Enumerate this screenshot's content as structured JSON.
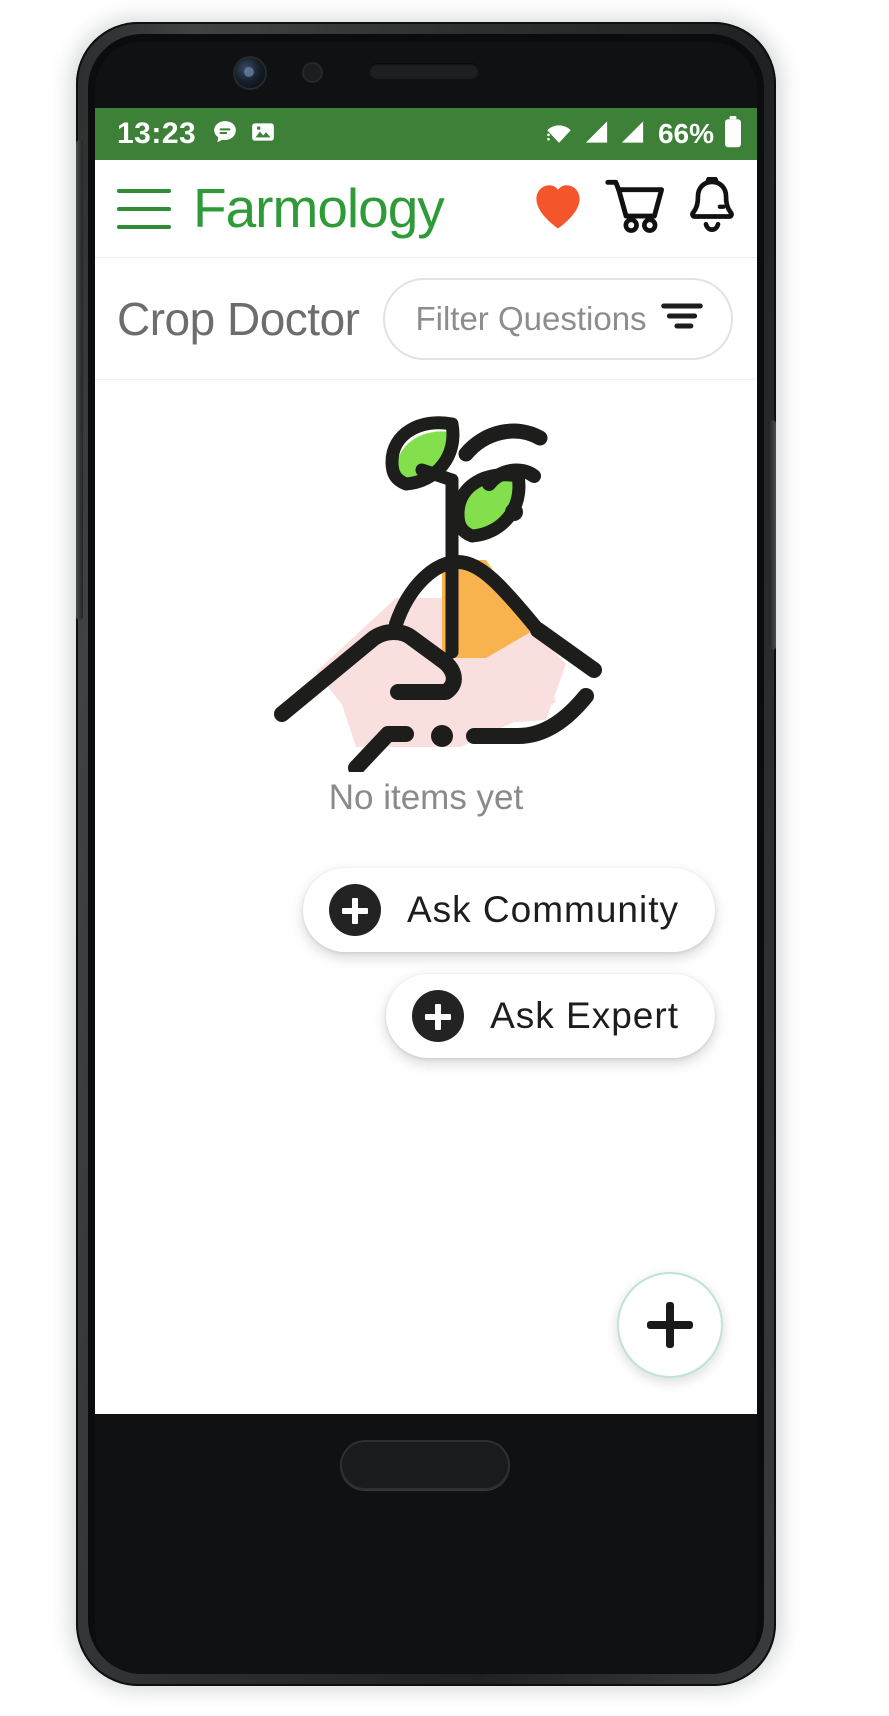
{
  "device": {
    "frame_color": "#2c2e30",
    "hardware": {
      "front_camera": "front-camera",
      "proximity_sensor": "proximity-sensor",
      "earpiece_speaker": "earpiece-speaker",
      "home_button": "home-button"
    }
  },
  "status_bar": {
    "background": "#3d8038",
    "time": "13:23",
    "left_icons": [
      "message-icon",
      "image-icon"
    ],
    "right_icons": [
      "wifi-icon",
      "signal-bars-icon",
      "signal-bars-icon"
    ],
    "battery_percent": "66%",
    "battery_icon": "battery-icon"
  },
  "app_bar": {
    "menu_icon": "hamburger-menu-icon",
    "brand": "Farmology",
    "brand_color": "#2e9b38",
    "icons": [
      {
        "name": "favorites-heart-icon",
        "color": "#f4552b"
      },
      {
        "name": "shopping-cart-icon",
        "color": "#111111"
      },
      {
        "name": "notifications-bell-icon",
        "color": "#111111"
      }
    ]
  },
  "sub_header": {
    "title": "Crop Doctor",
    "filter": {
      "label": "Filter Questions",
      "icon": "filter-icon"
    }
  },
  "content": {
    "illustration": {
      "name": "hand-holding-sprout-illustration",
      "stroke_color": "#1d1d1b",
      "leaf_color": "#84df4c",
      "soil_color": "#f9b34e",
      "palm_color": "#fadfdf",
      "has_wifi_signal": true
    },
    "empty_state_text": "No items yet",
    "actions": [
      {
        "label": "Ask Community",
        "icon": "plus-icon"
      },
      {
        "label": "Ask Expert",
        "icon": "plus-icon"
      }
    ],
    "fab": {
      "icon": "plus-icon",
      "border_color": "#bfe3d6"
    }
  }
}
